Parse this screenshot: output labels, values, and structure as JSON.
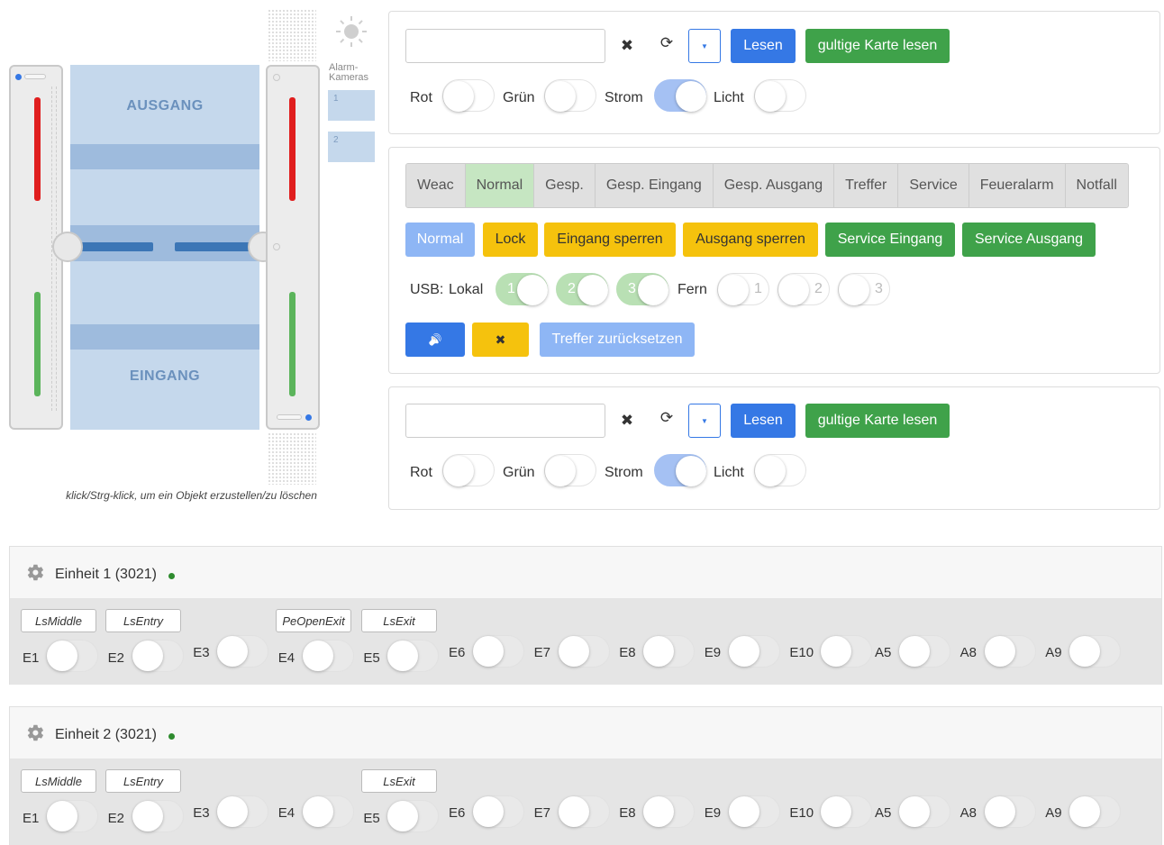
{
  "gate": {
    "exit_label": "AUSGANG",
    "entry_label": "EINGANG",
    "alarm_cameras_label": "Alarm-\nKameras",
    "cameras": [
      "1",
      "2"
    ],
    "hint": "klick/Strg-klick, um ein Objekt erzustellen/zu löschen",
    "colors": {
      "red": "#e01e1e",
      "green": "#5bb45b",
      "corridor": "#c5d8ec",
      "arm": "#3c76b6"
    }
  },
  "reader1": {
    "input_value": "",
    "clear_icon": "✖",
    "refresh_icon": "⟳",
    "dropdown_icon": "▼",
    "read_label": "Lesen",
    "valid_card_label": "gultige Karte lesen",
    "toggles": [
      {
        "label": "Rot",
        "on": false
      },
      {
        "label": "Grün",
        "on": false
      },
      {
        "label": "Strom",
        "on": true
      },
      {
        "label": "Licht",
        "on": false
      }
    ]
  },
  "reader2": {
    "input_value": "",
    "clear_icon": "✖",
    "refresh_icon": "⟳",
    "dropdown_icon": "▼",
    "read_label": "Lesen",
    "valid_card_label": "gultige Karte lesen",
    "toggles": [
      {
        "label": "Rot",
        "on": false
      },
      {
        "label": "Grün",
        "on": false
      },
      {
        "label": "Strom",
        "on": true
      },
      {
        "label": "Licht",
        "on": false
      }
    ]
  },
  "control": {
    "tabs": [
      "Weac",
      "Normal",
      "Gesp.",
      "Gesp. Eingang",
      "Gesp. Ausgang",
      "Treffer",
      "Service",
      "Feueralarm",
      "Notfall"
    ],
    "active_tab": "Normal",
    "modes": [
      "Normal",
      "Lock",
      "Eingang sperren",
      "Ausgang sperren",
      "Service Eingang",
      "Service Ausgang"
    ],
    "usb_label": "USB:",
    "local_label": "Lokal",
    "remote_label": "Fern",
    "local_toggles": [
      "1",
      "2",
      "3"
    ],
    "remote_toggles": [
      "1",
      "2",
      "3"
    ],
    "sound_icon": "🔊",
    "close_icon": "✖",
    "reset_hits_label": "Treffer zurücksetzen"
  },
  "units": [
    {
      "title": "Einheit 1 (3021)",
      "status_color": "#2e8b2e",
      "tags": [
        {
          "label": "LsMiddle",
          "col": 0
        },
        {
          "label": "LsEntry",
          "col": 1
        },
        {
          "label": "PeOpenExit",
          "col": 3
        },
        {
          "label": "LsExit",
          "col": 4
        }
      ],
      "io": [
        "E1",
        "E2",
        "E3",
        "E4",
        "E5",
        "E6",
        "E7",
        "E8",
        "E9",
        "E10",
        "A5",
        "A8",
        "A9"
      ]
    },
    {
      "title": "Einheit 2 (3021)",
      "status_color": "#2e8b2e",
      "tags": [
        {
          "label": "LsMiddle",
          "col": 0
        },
        {
          "label": "LsEntry",
          "col": 1
        },
        {
          "label": "LsExit",
          "col": 4
        }
      ],
      "io": [
        "E1",
        "E2",
        "E3",
        "E4",
        "E5",
        "E6",
        "E7",
        "E8",
        "E9",
        "E10",
        "A5",
        "A8",
        "A9"
      ]
    }
  ]
}
